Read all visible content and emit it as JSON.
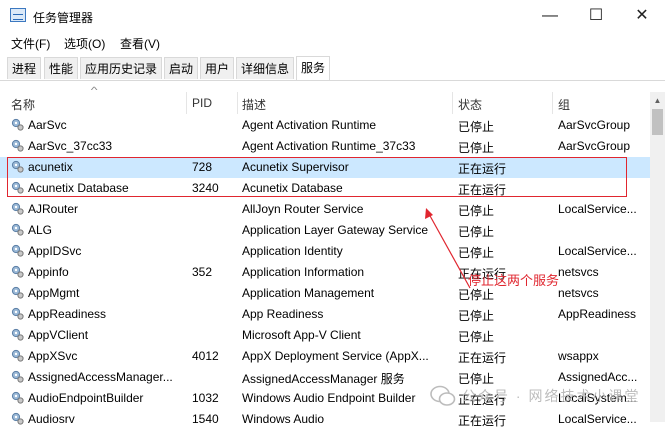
{
  "window": {
    "title": "任务管理器",
    "minimize": "—",
    "maximize": "☐",
    "close": "✕"
  },
  "menu": [
    "文件(F)",
    "选项(O)",
    "查看(V)"
  ],
  "tabs": [
    "进程",
    "性能",
    "应用历史记录",
    "启动",
    "用户",
    "详细信息",
    "服务"
  ],
  "active_tab": "服务",
  "columns": {
    "name": "名称",
    "pid": "PID",
    "desc": "描述",
    "status": "状态",
    "group": "组"
  },
  "rows": [
    {
      "name": "AarSvc",
      "pid": "",
      "desc": "Agent Activation Runtime",
      "status": "已停止",
      "group": "AarSvcGroup"
    },
    {
      "name": "AarSvc_37cc33",
      "pid": "",
      "desc": "Agent Activation Runtime_37c33",
      "status": "已停止",
      "group": "AarSvcGroup"
    },
    {
      "name": "acunetix",
      "pid": "728",
      "desc": "Acunetix Supervisor",
      "status": "正在运行",
      "group": ""
    },
    {
      "name": "Acunetix Database",
      "pid": "3240",
      "desc": "Acunetix Database",
      "status": "正在运行",
      "group": ""
    },
    {
      "name": "AJRouter",
      "pid": "",
      "desc": "AllJoyn Router Service",
      "status": "已停止",
      "group": "LocalService..."
    },
    {
      "name": "ALG",
      "pid": "",
      "desc": "Application Layer Gateway Service",
      "status": "已停止",
      "group": ""
    },
    {
      "name": "AppIDSvc",
      "pid": "",
      "desc": "Application Identity",
      "status": "已停止",
      "group": "LocalService..."
    },
    {
      "name": "Appinfo",
      "pid": "352",
      "desc": "Application Information",
      "status": "正在运行",
      "group": "netsvcs"
    },
    {
      "name": "AppMgmt",
      "pid": "",
      "desc": "Application Management",
      "status": "已停止",
      "group": "netsvcs"
    },
    {
      "name": "AppReadiness",
      "pid": "",
      "desc": "App Readiness",
      "status": "已停止",
      "group": "AppReadiness"
    },
    {
      "name": "AppVClient",
      "pid": "",
      "desc": "Microsoft App-V Client",
      "status": "已停止",
      "group": ""
    },
    {
      "name": "AppXSvc",
      "pid": "4012",
      "desc": "AppX Deployment Service (AppX...",
      "status": "正在运行",
      "group": "wsappx"
    },
    {
      "name": "AssignedAccessManager...",
      "pid": "",
      "desc": "AssignedAccessManager 服务",
      "status": "已停止",
      "group": "AssignedAcc..."
    },
    {
      "name": "AudioEndpointBuilder",
      "pid": "1032",
      "desc": "Windows Audio Endpoint Builder",
      "status": "正在运行",
      "group": "LocalSystem..."
    },
    {
      "name": "Audiosrv",
      "pid": "1540",
      "desc": "Windows Audio",
      "status": "正在运行",
      "group": "LocalService..."
    }
  ],
  "annotation": "停止这两个服务",
  "watermark": "公众号 · 网络技术小课堂",
  "colors": {
    "accent_red": "#e0262f",
    "selection": "#cce8ff"
  }
}
